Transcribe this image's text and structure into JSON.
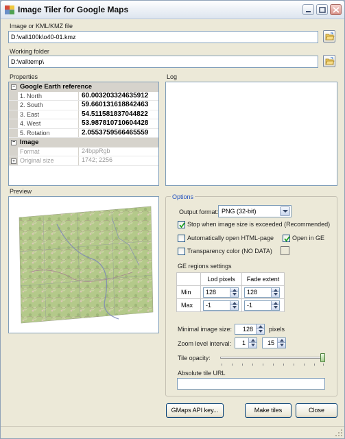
{
  "window": {
    "title": "Image Tiler for Google Maps"
  },
  "input": {
    "label": "Image or KML/KMZ file",
    "value": "D:\\val\\100k\\o40-01.kmz"
  },
  "working": {
    "label": "Working folder",
    "value": "D:\\val\\temp\\"
  },
  "properties": {
    "label": "Properties",
    "categories": [
      {
        "name": "Google Earth reference",
        "rows": [
          {
            "name": "1. North",
            "value": "60.003203324635912"
          },
          {
            "name": "2. South",
            "value": "59.660131618842463"
          },
          {
            "name": "3. East",
            "value": "54.511581837044822"
          },
          {
            "name": "4. West",
            "value": "53.987810710604428"
          },
          {
            "name": "5. Rotation",
            "value": "2.0553759566465559"
          }
        ]
      },
      {
        "name": "Image",
        "rows": [
          {
            "name": "Format",
            "value": "24bppRgb"
          },
          {
            "name": "Original size",
            "value": "1742; 2256"
          }
        ]
      }
    ]
  },
  "log": {
    "label": "Log"
  },
  "preview": {
    "label": "Preview"
  },
  "options": {
    "legend": "Options",
    "output_format_label": "Output format:",
    "output_format_value": "PNG (32-bit)",
    "stop_label": "Stop when image size is exceeded (Recommended)",
    "stop_checked": true,
    "auto_open_label": "Automatically open HTML-page",
    "auto_open_checked": false,
    "open_ge_label": "Open in GE",
    "open_ge_checked": true,
    "transparency_label": "Transparency color (NO DATA)",
    "transparency_checked": false,
    "ge_regions_label": "GE regions settings",
    "ge_table": {
      "headers": [
        "Lod pixels",
        "Fade extent"
      ],
      "rows": [
        {
          "label": "Min",
          "lod": "128",
          "fade": "128"
        },
        {
          "label": "Max",
          "lod": "-1",
          "fade": "-1"
        }
      ]
    },
    "min_size_label": "Minimal image size:",
    "min_size_value": "128",
    "min_size_unit": "pixels",
    "zoom_label": "Zoom level interval:",
    "zoom_min": "1",
    "zoom_max": "15",
    "opacity_label": "Tile opacity:",
    "opacity_value": 1.0,
    "abs_url_label": "Absolute tile URL",
    "abs_url_value": ""
  },
  "buttons": {
    "gmaps": "GMaps API key...",
    "make": "Make tiles",
    "close": "Close"
  },
  "colors": {
    "accent": "#1f4fbf",
    "window_bg": "#ece9d8",
    "border": "#7f9db9"
  }
}
